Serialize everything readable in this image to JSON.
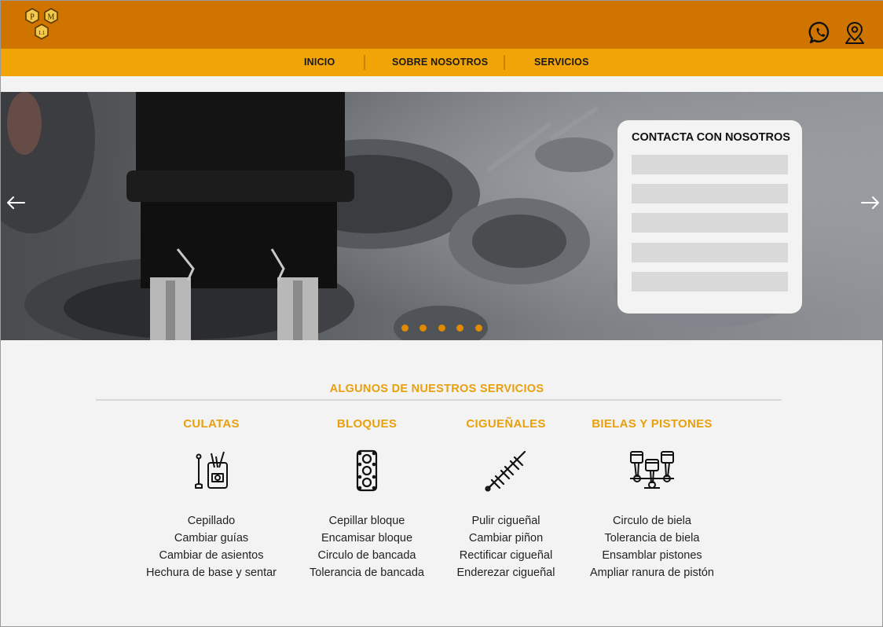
{
  "header": {
    "logo_letters": [
      "P",
      "M",
      "1.1"
    ],
    "icons": [
      "whatsapp-icon",
      "location-pin-icon"
    ],
    "colors": {
      "top": "#d07400",
      "nav": "#f1a405",
      "accent": "#e8a00c",
      "dot": "#e08a00"
    }
  },
  "nav": {
    "items": [
      {
        "label": "INICIO"
      },
      {
        "label": "SOBRE NOSOTROS"
      },
      {
        "label": "SERVICIOS"
      }
    ]
  },
  "hero": {
    "slide_count": 5,
    "prev_icon": "arrow-left-icon",
    "next_icon": "arrow-right-icon",
    "contact": {
      "title": "CONTACTA CON NOSOTROS",
      "fields": 5
    }
  },
  "services": {
    "title": "ALGUNOS DE NUESTROS SERVICIOS",
    "columns": [
      {
        "title": "CULATAS",
        "icon": "cylinder-head-icon",
        "items": [
          "Cepillado",
          "Cambiar guías",
          "Cambiar de asientos",
          "Hechura de base y sentar"
        ]
      },
      {
        "title": "BLOQUES",
        "icon": "engine-block-icon",
        "items": [
          "Cepillar bloque",
          "Encamisar bloque",
          "Circulo de bancada",
          "Tolerancia de bancada"
        ]
      },
      {
        "title": "CIGUEÑALES",
        "icon": "crankshaft-icon",
        "items": [
          "Pulir cigueñal",
          "Cambiar piñon",
          "Rectificar cigueñal",
          "Enderezar cigueñal"
        ]
      },
      {
        "title": "BIELAS Y PISTONES",
        "icon": "pistons-icon",
        "items": [
          "Circulo de biela",
          "Tolerancia de biela",
          "Ensamblar pistones",
          "Ampliar ranura de pistón"
        ]
      }
    ]
  }
}
